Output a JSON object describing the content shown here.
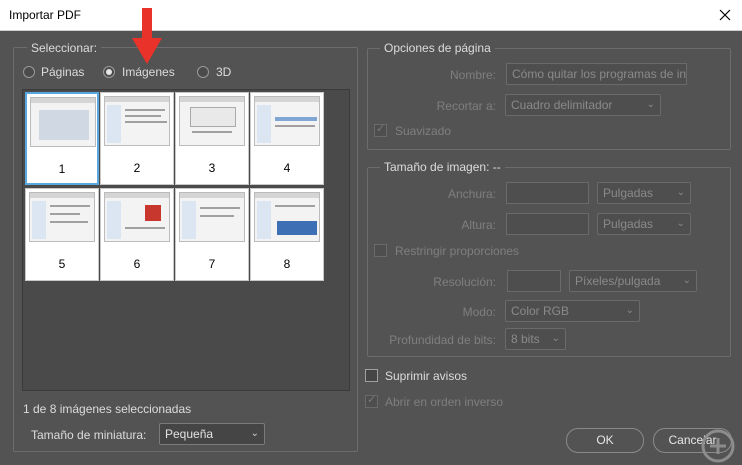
{
  "window": {
    "title": "Importar PDF"
  },
  "select_group": {
    "legend": "Seleccionar:",
    "options": [
      {
        "label": "Páginas",
        "checked": false
      },
      {
        "label": "Imágenes",
        "checked": true
      },
      {
        "label": "3D",
        "checked": false
      }
    ],
    "thumbnails": [
      "1",
      "2",
      "3",
      "4",
      "5",
      "6",
      "7",
      "8"
    ],
    "selected_thumbnail": "1",
    "status": "1 de 8 imágenes seleccionadas",
    "thumb_size_label": "Tamaño de miniatura:",
    "thumb_size_value": "Pequeña"
  },
  "page_options": {
    "legend": "Opciones de página",
    "name_label": "Nombre:",
    "name_value": "Cómo quitar los programas de in",
    "crop_label": "Recortar a:",
    "crop_value": "Cuadro delimitador",
    "antialias_label": "Suavizado",
    "antialias_checked": true
  },
  "image_size": {
    "legend": "Tamaño de imagen: --",
    "width_label": "Anchura:",
    "width_value": "",
    "width_unit": "Pulgadas",
    "height_label": "Altura:",
    "height_value": "",
    "height_unit": "Pulgadas",
    "constrain_label": "Restringir proporciones",
    "resolution_label": "Resolución:",
    "resolution_value": "",
    "resolution_unit": "Píxeles/pulgada",
    "mode_label": "Modo:",
    "mode_value": "Color RGB",
    "depth_label": "Profundidad de bits:",
    "depth_value": "8 bits"
  },
  "options": {
    "suppress_warnings": "Suprimir avisos",
    "reverse_order": "Abrir en orden inverso"
  },
  "buttons": {
    "ok": "OK",
    "cancel": "Cancelar"
  },
  "colors": {
    "dialog_bg": "#535353",
    "selection_border": "#5aa8e0",
    "annotation_arrow": "#e8322a"
  },
  "icons": {
    "close": "close-icon",
    "annotation": "red-arrow-icon",
    "watermark": "plus-logo-icon"
  }
}
